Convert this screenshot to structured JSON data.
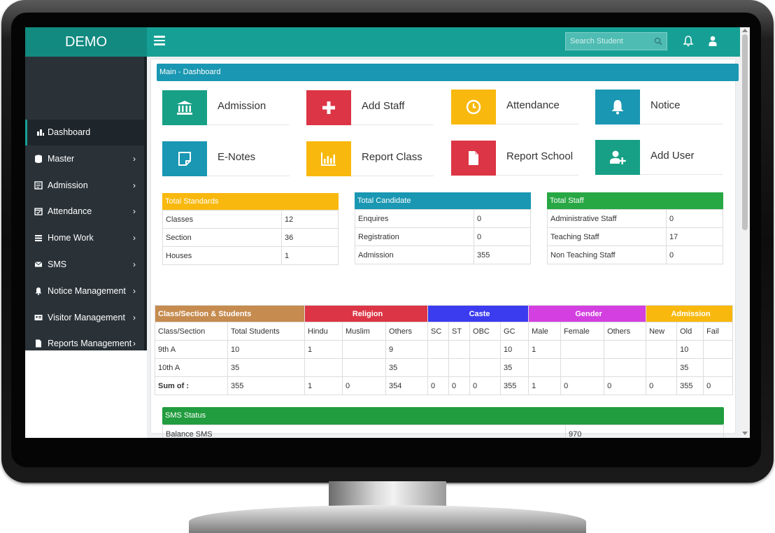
{
  "app": {
    "brand": "DEMO"
  },
  "search": {
    "placeholder": "Search Student"
  },
  "sidebar": {
    "items": [
      {
        "label": "Dashboard",
        "icon": "dashboard-icon",
        "active": true
      },
      {
        "label": "Master",
        "icon": "database-icon"
      },
      {
        "label": "Admission",
        "icon": "form-icon"
      },
      {
        "label": "Attendance",
        "icon": "calendar-icon"
      },
      {
        "label": "Home Work",
        "icon": "list-icon"
      },
      {
        "label": "SMS",
        "icon": "envelope-icon"
      },
      {
        "label": "Notice Management",
        "icon": "bell-icon"
      },
      {
        "label": "Visitor Management",
        "icon": "id-card-icon"
      },
      {
        "label": "Reports Management",
        "icon": "file-icon"
      }
    ]
  },
  "breadcrumb": "Main - Dashboard",
  "tiles": [
    {
      "label": "Admission",
      "color": "#17a086",
      "icon": "bank-icon"
    },
    {
      "label": "Add Staff",
      "color": "#dc3545",
      "icon": "plus-icon"
    },
    {
      "label": "Attendance",
      "color": "#f8b80d",
      "icon": "clock-icon"
    },
    {
      "label": "Notice",
      "color": "#1a97b2",
      "icon": "bell-icon"
    },
    {
      "label": "E-Notes",
      "color": "#1a97b2",
      "icon": "note-icon"
    },
    {
      "label": "Report Class",
      "color": "#f8b80d",
      "icon": "bar-chart-icon"
    },
    {
      "label": "Report School",
      "color": "#dc3545",
      "icon": "document-icon"
    },
    {
      "label": "Add User",
      "color": "#17a086",
      "icon": "add-user-icon"
    }
  ],
  "stats": [
    {
      "title": "Total Standards",
      "color": "#f8b80d",
      "rows": [
        [
          "Classes",
          "12"
        ],
        [
          "Section",
          "36"
        ],
        [
          "Houses",
          "1"
        ]
      ]
    },
    {
      "title": "Total Candidate",
      "color": "#1a97b2",
      "rows": [
        [
          "Enquires",
          "0"
        ],
        [
          "Registration",
          "0"
        ],
        [
          "Admission",
          "355"
        ]
      ]
    },
    {
      "title": "Total Staff",
      "color": "#28a745",
      "rows": [
        [
          "Administrative Staff",
          "0"
        ],
        [
          "Teaching Staff",
          "17"
        ],
        [
          "Non Teaching Staff",
          "0"
        ]
      ]
    }
  ],
  "summary": {
    "groups": [
      {
        "label": "Class/Section & Students",
        "color": "#c68b4f",
        "span": 2
      },
      {
        "label": "Religion",
        "color": "#dc3545",
        "span": 3
      },
      {
        "label": "Caste",
        "color": "#3b3bf0",
        "span": 4
      },
      {
        "label": "Gender",
        "color": "#d33fe0",
        "span": 3
      },
      {
        "label": "Admission",
        "color": "#f8b80d",
        "span": 3
      }
    ],
    "headers": [
      "Class/Section",
      "Total Students",
      "Hindu",
      "Muslim",
      "Others",
      "SC",
      "ST",
      "OBC",
      "GC",
      "Male",
      "Female",
      "Others",
      "New",
      "Old",
      "Fail"
    ],
    "rows": [
      [
        "9th A",
        "10",
        "1",
        "",
        "9",
        "",
        "",
        "",
        "10",
        "1",
        "",
        "",
        "",
        "10",
        ""
      ],
      [
        "10th A",
        "35",
        "",
        "",
        "35",
        "",
        "",
        "",
        "35",
        "",
        "",
        "",
        "",
        "35",
        ""
      ],
      [
        "Sum of :",
        "355",
        "1",
        "0",
        "354",
        "0",
        "0",
        "0",
        "355",
        "1",
        "0",
        "0",
        "0",
        "355",
        "0"
      ]
    ]
  },
  "sms": {
    "title": "SMS Status",
    "label": "Balance SMS",
    "value": "970"
  }
}
